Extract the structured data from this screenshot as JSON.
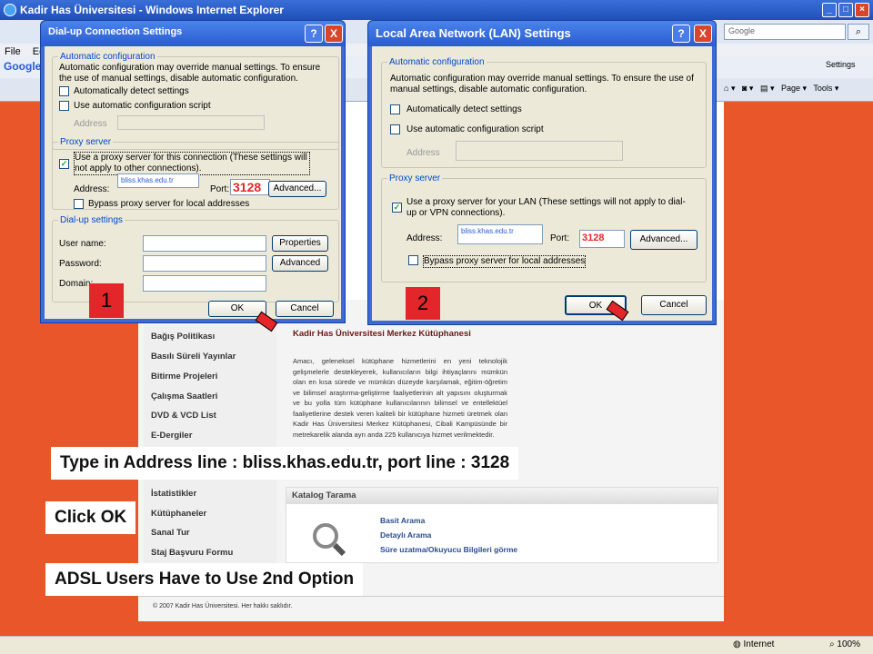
{
  "browser": {
    "title": "Kadir Has Üniversitesi - Windows Internet Explorer",
    "menu": [
      "File",
      "Edit"
    ],
    "search_placeholder": "Google",
    "google_label": "Google",
    "settings_label": "Settings",
    "page_label": "Page",
    "tools_label": "Tools"
  },
  "page": {
    "sidebar_items": [
      "Bağış Politikası",
      "Basılı Süreli Yayınlar",
      "Bitirme Projeleri",
      "Çalışma Saatleri",
      "DVD & VCD List",
      "E-Dergiler",
      "İstatistikler",
      "Kütüphaneler",
      "Sanal Tur",
      "Staj Başvuru Formu"
    ],
    "content_title": "Kadir Has Üniversitesi Merkez Kütüphanesi",
    "content_body": "Amacı, geleneksel kütüphane hizmetlerini en yeni teknolojik gelişmelerle destekleyerek, kullanıcıların bilgi ihtiyaçlarını mümkün olan en kısa sürede ve mümkün düzeyde karşılamak, eğitim-öğretim ve bilimsel araştırma-geliştirme faaliyetlerinin alt yapısını oluşturmak ve bu yolla tüm kütüphane kullanıcılarının bilimsel ve entellektüel faaliyetlerine destek veren kaliteli bir kütüphane hizmeti üretmek olan Kadir Has Üniversitesi Merkez Kütüphanesi, Cibali Kampüsünde bir metrekarelik alanda ayrı anda 225 kullanıcıya hizmet verilmektedir.",
    "katalog_title": "Katalog Tarama",
    "katalog_links": [
      "Basit Arama",
      "Detaylı Arama",
      "Süre uzatma/Okuyucu Bilgileri görme"
    ],
    "footer": "© 2007 Kadir Has Üniversitesi. Her hakkı saklıdır."
  },
  "status": {
    "zone": "Internet",
    "zoom": "100%"
  },
  "dialup": {
    "title": "Dial-up Connection Settings",
    "auto_legend": "Automatic configuration",
    "auto_desc": "Automatic configuration may override manual settings. To ensure the use of manual settings, disable automatic configuration.",
    "auto_detect": "Automatically detect settings",
    "auto_script": "Use automatic configuration script",
    "address_label": "Address",
    "proxy_legend": "Proxy server",
    "proxy_use": "Use a proxy server for this connection (These settings will not apply to other connections).",
    "proxy_address_label": "Address:",
    "proxy_address_value": "bliss.khas.edu.tr",
    "port_label": "Port:",
    "port_value": "3128",
    "advanced": "Advanced...",
    "bypass": "Bypass proxy server for local addresses",
    "dial_legend": "Dial-up settings",
    "user_name": "User name:",
    "password": "Password:",
    "domain": "Domain:",
    "properties": "Properties",
    "advanced2": "Advanced",
    "ok": "OK",
    "cancel": "Cancel",
    "help": "?",
    "close": "X"
  },
  "lan": {
    "title": "Local Area Network (LAN) Settings",
    "auto_legend": "Automatic configuration",
    "auto_desc": "Automatic configuration may override manual settings.  To ensure the use of manual settings, disable automatic configuration.",
    "auto_detect": "Automatically detect settings",
    "auto_script": "Use automatic configuration script",
    "address_label": "Address",
    "proxy_legend": "Proxy server",
    "proxy_use": "Use a proxy server for your LAN (These settings will not apply to dial-up or VPN connections).",
    "proxy_address_label": "Address:",
    "proxy_address_value": "bliss.khas.edu.tr",
    "port_label": "Port:",
    "port_value": "3128",
    "advanced": "Advanced...",
    "bypass": "Bypass proxy server for local addresses",
    "ok": "OK",
    "cancel": "Cancel",
    "help": "?",
    "close": "X"
  },
  "annotations": {
    "step1": "1",
    "step2": "2",
    "callout1": "Type in Address line : bliss.khas.edu.tr, port line : 3128",
    "callout2": "Click OK",
    "callout3": "ADSL Users Have to Use 2nd Option"
  },
  "colors": {
    "accent": "#e3262a",
    "background": "#e8562a",
    "titlebar": "#2a5bd0"
  }
}
